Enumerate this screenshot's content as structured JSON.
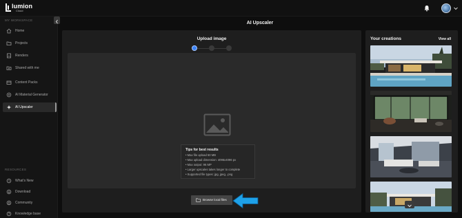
{
  "app": {
    "logo_text": "lumion",
    "logo_sub": "Cloud"
  },
  "sidebar": {
    "workspace_label": "MY WORKSPACE",
    "items": [
      {
        "label": "Home",
        "icon": "home-icon"
      },
      {
        "label": "Projects",
        "icon": "folder-icon"
      },
      {
        "label": "Renders",
        "icon": "renders-icon"
      },
      {
        "label": "Shared with me",
        "icon": "shared-folder-icon"
      },
      {
        "label": "Content Packs",
        "icon": "content-packs-icon"
      },
      {
        "label": "AI Material Generator",
        "icon": "material-generator-icon"
      },
      {
        "label": "AI Upscaler",
        "icon": "sparkle-icon",
        "active": true
      }
    ],
    "resources_label": "RESOURCES",
    "resources": [
      {
        "label": "What's New",
        "icon": "whats-new-icon"
      },
      {
        "label": "Download",
        "icon": "download-icon"
      },
      {
        "label": "Community",
        "icon": "community-icon"
      },
      {
        "label": "Knowledge base",
        "icon": "knowledge-base-icon"
      }
    ]
  },
  "main": {
    "title": "AI Upscaler",
    "upload": {
      "title": "Upload image",
      "steps_total": 3,
      "current_step": 1,
      "tips_title": "Tips for best results",
      "tips": [
        "• Max file upload 50 MB",
        "• Max upload dimension: 4096x4096 px",
        "• Max output: 96 MP",
        "• Larger upscales takes longer to complete",
        "• Supported file types: jpg, jpeg, .png"
      ],
      "browse_label": "Browse local files"
    },
    "creations": {
      "title": "Your creations",
      "view_all": "View all"
    }
  },
  "colors": {
    "accent": "#3b82f6",
    "arrow": "#1ea1e8",
    "panel": "#1e1e1e",
    "background": "#0e0e0e"
  }
}
